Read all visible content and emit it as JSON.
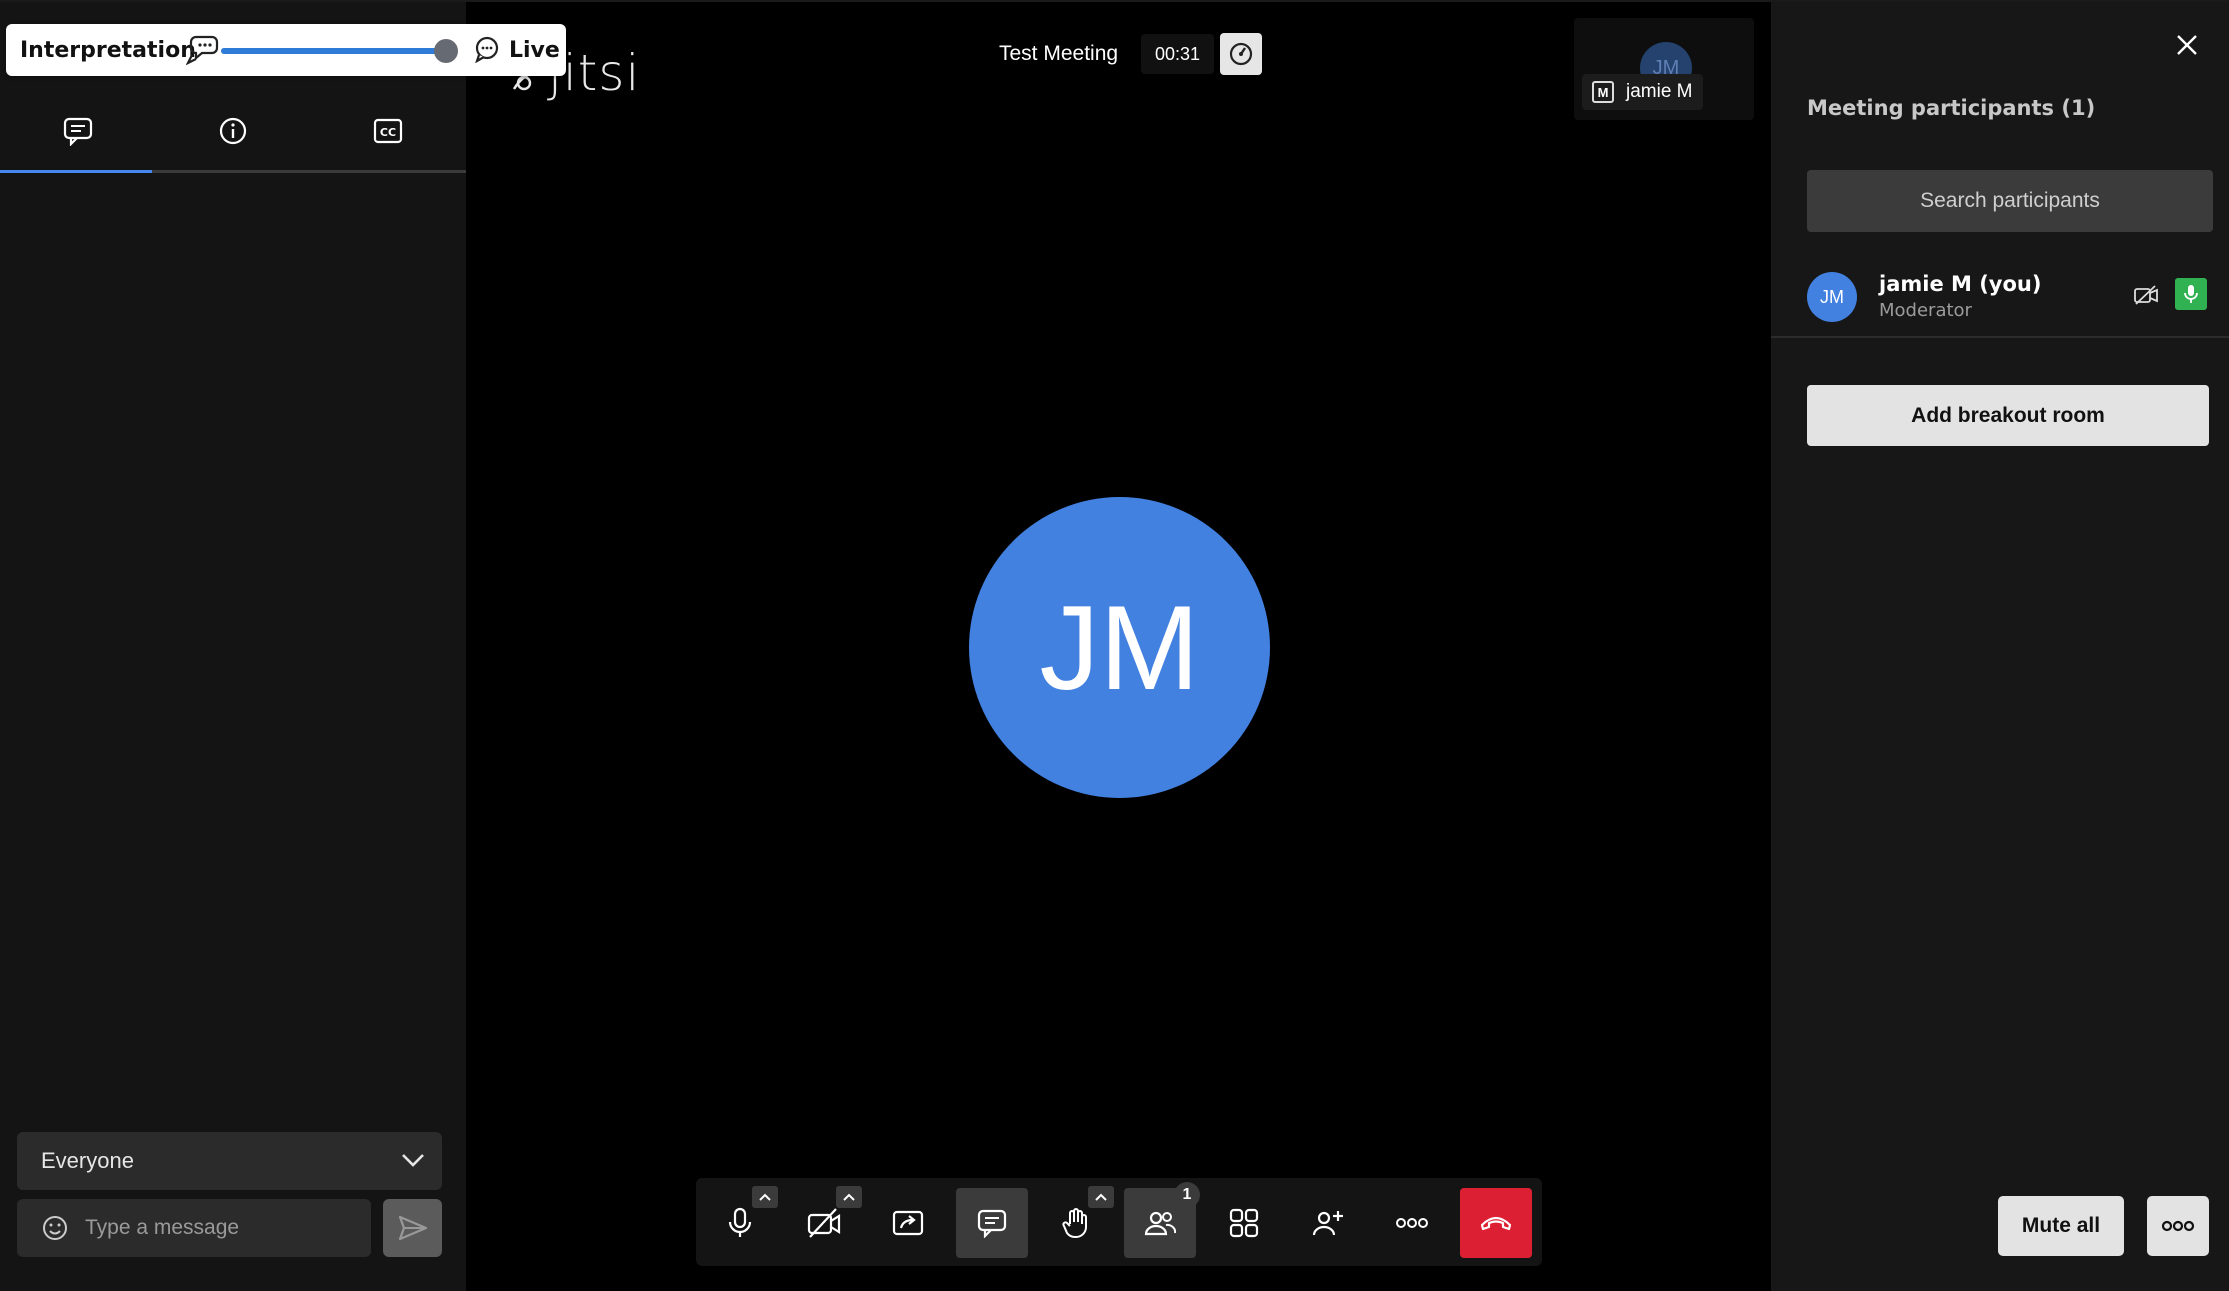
{
  "interpretation": {
    "label": "Interpretation",
    "live_label": "Live",
    "slider_value": 0.98
  },
  "chat": {
    "tabs": [
      {
        "name": "chat",
        "icon": "chat-bubble-icon"
      },
      {
        "name": "info",
        "icon": "info-icon"
      },
      {
        "name": "captions",
        "icon": "cc-icon"
      }
    ],
    "recipient": "Everyone",
    "message_placeholder": "Type a message"
  },
  "stage": {
    "logo": "jitsi",
    "meeting_title": "Test Meeting",
    "timer": "00:31",
    "avatar_initials": "JM",
    "filmstrip": {
      "initials": "JM",
      "name": "jamie M",
      "badge": "M"
    }
  },
  "toolbar": {
    "participants_count": "1",
    "buttons": [
      "microphone",
      "camera",
      "share-screen",
      "chat",
      "raise-hand",
      "participants",
      "tile-view",
      "invite",
      "more",
      "leave"
    ]
  },
  "participants_panel": {
    "title": "Meeting participants (1)",
    "search_placeholder": "Search participants",
    "participants": [
      {
        "initials": "JM",
        "name": "jamie M (you)",
        "role": "Moderator"
      }
    ],
    "add_breakout_label": "Add breakout room",
    "mute_all_label": "Mute all"
  },
  "colors": {
    "accent": "#4687ed",
    "avatar": "#4281e0",
    "hangup": "#dd1f33",
    "mic_active": "#31b252"
  }
}
